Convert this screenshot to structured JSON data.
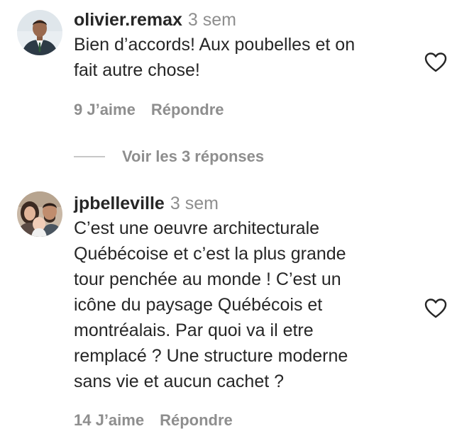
{
  "comments": [
    {
      "username": "olivier.remax",
      "time": "3 sem",
      "text_lines": [
        "Bien d’accords! Aux poubelles et on",
        "fait autre chose!"
      ],
      "likes_label": "9 J’aime",
      "reply_label": "Répondre",
      "avatar_icon": "profile-photo-man-suit"
    },
    {
      "username": "jpbelleville",
      "time": "3 sem",
      "text_lines": [
        "C’est une oeuvre architecturale",
        "Québécoise et c’est la plus grande",
        "tour penchée au monde ! C’est un",
        "icône du paysage Québécois et",
        "montréalais. Par quoi va il etre",
        "remplacé ? Une structure moderne",
        "sans vie et aucun cachet ?"
      ],
      "likes_label": "14 J’aime",
      "reply_label": "Répondre",
      "avatar_icon": "profile-photo-family"
    }
  ],
  "view_replies_label": "Voir les 3 réponses",
  "colors": {
    "text": "#262626",
    "secondary": "#8e8e8e",
    "divider": "#c7c7c7"
  },
  "icons": {
    "like": "heart-outline-icon"
  }
}
